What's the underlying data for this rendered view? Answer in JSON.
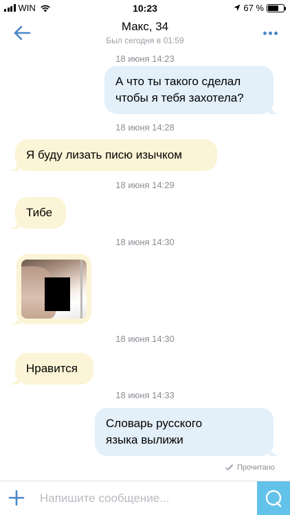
{
  "status_bar": {
    "carrier": "WIN",
    "time": "10:23",
    "battery_text": "67 %",
    "battery_level": 0.67,
    "icons": [
      "signal-icon",
      "wifi-icon",
      "location-arrow-icon",
      "battery-icon"
    ]
  },
  "header": {
    "title": "Макс, 34",
    "subtitle": "Был сегодня в 01:59",
    "back_icon": "back-arrow-icon",
    "more_icon": "more-dots-icon",
    "accent_color": "#4a86c8"
  },
  "messages": [
    {
      "timestamp": "18 июня 14:23",
      "direction": "out",
      "lines": [
        "А что ты такого сделал",
        "чтобы я тебя захотела?"
      ]
    },
    {
      "timestamp": "18 июня 14:28",
      "direction": "in",
      "lines": [
        "Я буду лизать писю изычком"
      ]
    },
    {
      "timestamp": "18 июня 14:29",
      "direction": "in",
      "lines": [
        "Тибе"
      ]
    },
    {
      "timestamp": "18 июня 14:30",
      "direction": "in",
      "type": "photo"
    },
    {
      "timestamp": "18 июня 14:30",
      "direction": "in",
      "lines": [
        "Нравится"
      ]
    },
    {
      "timestamp": "18 июня 14:33",
      "direction": "out",
      "lines": [
        "Словарь русского",
        "языка вылижи"
      ]
    }
  ],
  "read_status": "Прочитано",
  "composer": {
    "placeholder": "Напишите сообщение...",
    "add_icon": "plus-icon",
    "send_icon": "send-bubble-icon",
    "send_color": "#62c2e9"
  },
  "colors": {
    "outgoing_bubble": "#e3eff9",
    "incoming_bubble": "#fcf4d6",
    "timestamp_text": "#8a8d93"
  }
}
